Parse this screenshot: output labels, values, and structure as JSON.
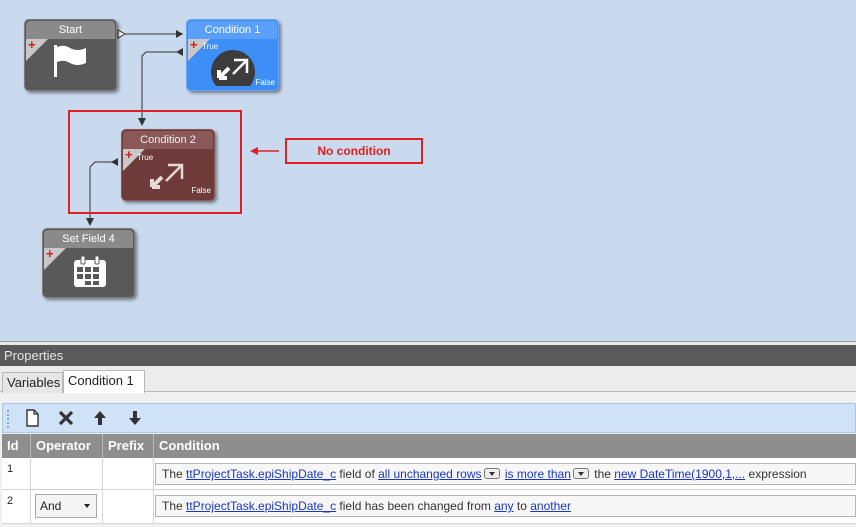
{
  "canvas": {
    "nodes": {
      "start": {
        "title": "Start"
      },
      "condition1": {
        "title": "Condition 1",
        "true_label": "True",
        "false_label": "False"
      },
      "condition2": {
        "title": "Condition 2",
        "true_label": "True",
        "false_label": "False"
      },
      "set_field": {
        "title": "Set Field 4"
      }
    },
    "annotation": {
      "text": "No condition",
      "color": "#e02020"
    }
  },
  "properties": {
    "header": "Properties",
    "tabs": [
      {
        "label": "Variables",
        "active": false
      },
      {
        "label": "Condition 1",
        "active": true
      }
    ],
    "toolbar": {
      "icons": [
        "new-document-icon",
        "delete-x-icon",
        "move-up-icon",
        "move-down-icon"
      ]
    },
    "grid": {
      "columns": [
        "Id",
        "Operator",
        "Prefix",
        "Condition"
      ],
      "rows": [
        {
          "id": "1",
          "operator": "",
          "prefix": "",
          "parts": {
            "t1": "The ",
            "l1": "ttProjectTask.epiShipDate_c",
            "t2": " field of ",
            "l2": "all unchanged rows",
            "t3": " ",
            "l3": "is more than",
            "t4": " the ",
            "l4": "new DateTime(1900,1,...",
            "t5": " expression"
          }
        },
        {
          "id": "2",
          "operator": "And",
          "prefix": "",
          "parts": {
            "t1": "The ",
            "l1": "ttProjectTask.epiShipDate_c",
            "t2": " field has been changed from ",
            "l2": "any",
            "t3": " to ",
            "l3": "another"
          }
        }
      ]
    }
  }
}
